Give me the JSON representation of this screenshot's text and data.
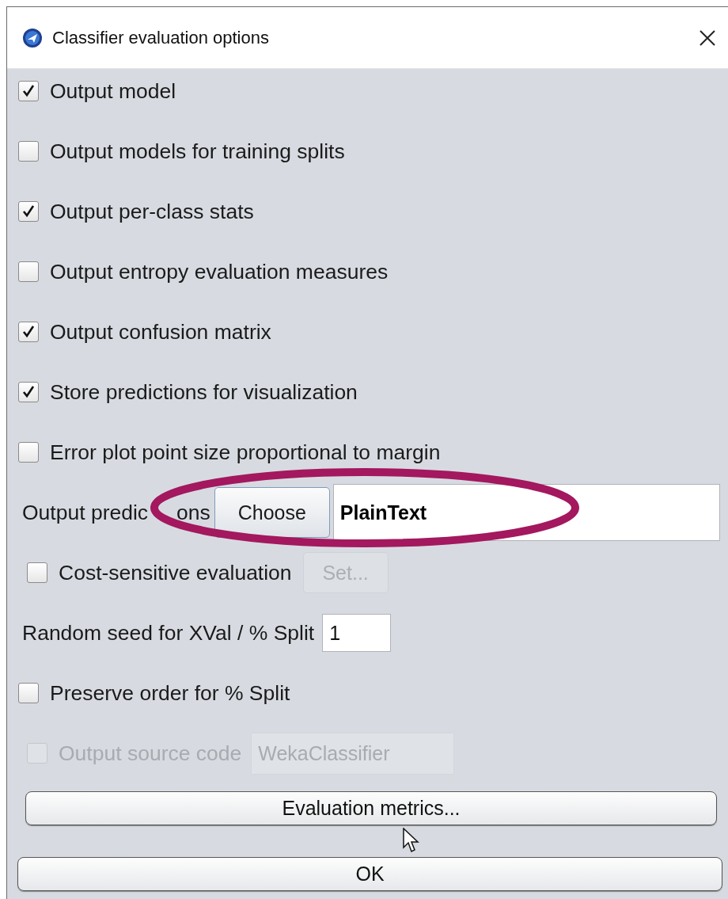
{
  "window": {
    "title": "Classifier evaluation options"
  },
  "rows": [
    {
      "kind": "checkbox",
      "label": "Output model",
      "checked": true
    },
    {
      "kind": "checkbox",
      "label": "Output models for training splits",
      "checked": false
    },
    {
      "kind": "checkbox",
      "label": "Output per-class stats",
      "checked": true
    },
    {
      "kind": "checkbox",
      "label": "Output entropy evaluation measures",
      "checked": false
    },
    {
      "kind": "checkbox",
      "label": "Output confusion matrix",
      "checked": true
    },
    {
      "kind": "checkbox",
      "label": "Store predictions for visualization",
      "checked": true
    },
    {
      "kind": "checkbox",
      "label": "Error plot point size proportional to margin",
      "checked": false
    },
    {
      "kind": "chooser",
      "label_parts": [
        "Output predic",
        "ons"
      ],
      "button": "Choose",
      "value": "PlainText"
    },
    {
      "kind": "checkbox-button",
      "label": "Cost-sensitive evaluation",
      "checked": false,
      "button": "Set...",
      "disabled": true
    },
    {
      "kind": "number-field",
      "label": "Random seed for XVal / % Split",
      "value": "1"
    },
    {
      "kind": "checkbox",
      "label": "Preserve order for % Split",
      "checked": false
    },
    {
      "kind": "checkbox-field",
      "label": "Output source code",
      "checked": false,
      "value": "WekaClassifier",
      "disabled": true
    }
  ],
  "buttons": [
    "Evaluation metrics...",
    "OK"
  ]
}
